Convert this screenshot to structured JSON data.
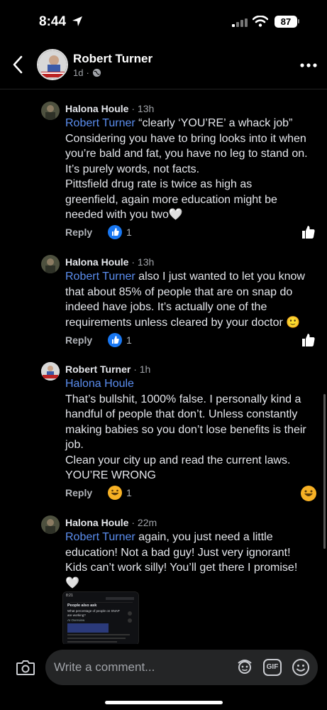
{
  "status": {
    "time": "8:44",
    "battery": "87"
  },
  "header": {
    "name": "Robert Turner",
    "age": "1d"
  },
  "comments": [
    {
      "author": "Halona Houle",
      "time": "13h",
      "mention": "Robert Turner",
      "lines": [
        " “clearly ‘YOU’RE’ a whack job”",
        "Considering you have to bring looks into it when",
        "you’re bald and fat, you have no leg to stand on.",
        "It’s purely words, not facts.",
        "Pittsfield drug rate is twice as high as",
        "greenfield, again more education might be",
        "needed with you two🤍"
      ],
      "reply_label": "Reply",
      "reaction": "like",
      "reaction_count": "1"
    },
    {
      "author": "Halona Houle",
      "time": "13h",
      "mention": "Robert Turner",
      "lines": [
        " also I just wanted to let you know",
        "that about 85% of people that are on snap do",
        "indeed have jobs. It’s actually one of the",
        "requirements unless cleared by your doctor 🙂"
      ],
      "reply_label": "Reply",
      "reaction": "like",
      "reaction_count": "1"
    },
    {
      "author": "Robert Turner",
      "time": "1h",
      "mention": "Halona Houle",
      "lines": [
        "That’s bullshit, 1000% false.  I personally kind a",
        "handful of people that don’t.  Unless constantly",
        "making babies so you don’t lose benefits is their",
        "job.",
        "  Clean your city up and read the current laws.",
        "YOU’RE WRONG"
      ],
      "reply_label": "Reply",
      "reaction": "haha",
      "reaction_count": "1"
    },
    {
      "author": "Halona Houle",
      "time": "22m",
      "mention": "Robert Turner",
      "lines": [
        " again, you just need a little",
        "education! Not a bad guy! Just very ignorant!",
        "Kids can’t work silly! You’ll get there I promise!",
        "🤍"
      ]
    }
  ],
  "screenshot_thumb": {
    "time": "8:21",
    "heading": "People also ask",
    "question": "What percentage of people on SNAP are working?",
    "tag": "AI Overview"
  },
  "composer": {
    "placeholder": "Write a comment...",
    "gif_label": "GIF"
  },
  "colors": {
    "mention": "#5b8ef0",
    "like": "#1877f2",
    "haha": "#f7b125",
    "background": "#000000"
  },
  "icons": [
    "location-arrow-icon",
    "signal-icon",
    "wifi-icon",
    "back-arrow-icon",
    "globe-icon",
    "more-icon",
    "like-icon",
    "haha-icon",
    "camera-icon",
    "avatar-sticker-icon",
    "gif-icon",
    "emoji-icon"
  ]
}
